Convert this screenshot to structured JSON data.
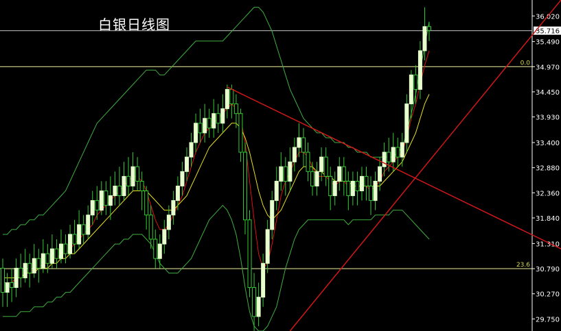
{
  "title": "白银日线图",
  "chart_data": {
    "type": "candlestick",
    "title": "白银日线图",
    "ylim": [
      29.5,
      36.35
    ],
    "y_ticks": [
      "36.020",
      "35.490",
      "34.970",
      "34.450",
      "33.930",
      "33.400",
      "32.880",
      "32.360",
      "31.840",
      "31.310",
      "30.790",
      "30.270",
      "29.750"
    ],
    "current_price": "35.716",
    "fib_levels": [
      {
        "label": "0.0",
        "value": 34.97
      },
      {
        "label": "23.6",
        "value": 30.79
      }
    ],
    "candles": [
      [
        30.8,
        30.3,
        31.0,
        30.0
      ],
      [
        30.3,
        30.5,
        30.7,
        30.0
      ],
      [
        30.5,
        30.4,
        30.8,
        30.1
      ],
      [
        30.4,
        30.8,
        31.0,
        30.2
      ],
      [
        30.8,
        30.6,
        31.1,
        30.4
      ],
      [
        30.6,
        30.9,
        31.2,
        30.5
      ],
      [
        30.9,
        30.7,
        31.1,
        30.4
      ],
      [
        30.7,
        31.0,
        31.3,
        30.6
      ],
      [
        31.0,
        30.8,
        31.2,
        30.5
      ],
      [
        30.8,
        31.1,
        31.4,
        30.7
      ],
      [
        31.1,
        30.9,
        31.3,
        30.7
      ],
      [
        30.9,
        31.2,
        31.5,
        30.8
      ],
      [
        31.2,
        31.0,
        31.4,
        30.8
      ],
      [
        31.0,
        31.3,
        31.6,
        30.9
      ],
      [
        31.3,
        31.1,
        31.5,
        30.9
      ],
      [
        31.1,
        31.5,
        31.7,
        31.0
      ],
      [
        31.5,
        31.3,
        31.8,
        31.1
      ],
      [
        31.3,
        31.7,
        32.0,
        31.2
      ],
      [
        31.7,
        31.5,
        31.9,
        31.3
      ],
      [
        31.5,
        31.9,
        32.1,
        31.4
      ],
      [
        31.9,
        32.2,
        32.4,
        31.7
      ],
      [
        32.2,
        32.0,
        32.5,
        31.8
      ],
      [
        32.0,
        32.4,
        32.6,
        31.9
      ],
      [
        32.4,
        32.1,
        32.6,
        31.9
      ],
      [
        32.1,
        32.3,
        32.7,
        31.8
      ],
      [
        32.3,
        32.5,
        32.8,
        32.1
      ],
      [
        32.5,
        32.3,
        32.9,
        32.1
      ],
      [
        32.3,
        32.7,
        33.0,
        32.2
      ],
      [
        32.7,
        32.5,
        33.1,
        32.3
      ],
      [
        32.5,
        32.9,
        33.2,
        32.4
      ],
      [
        32.9,
        32.6,
        33.1,
        32.4
      ],
      [
        32.6,
        32.4,
        32.8,
        32.0
      ],
      [
        32.4,
        31.9,
        32.5,
        31.6
      ],
      [
        31.9,
        31.4,
        32.1,
        31.2
      ],
      [
        31.4,
        31.0,
        31.6,
        30.8
      ],
      [
        31.0,
        31.3,
        31.5,
        30.8
      ],
      [
        31.3,
        31.6,
        31.8,
        31.1
      ],
      [
        31.6,
        31.9,
        32.1,
        31.4
      ],
      [
        31.9,
        32.2,
        32.4,
        31.7
      ],
      [
        32.2,
        32.5,
        32.7,
        32.0
      ],
      [
        32.5,
        32.8,
        33.0,
        32.3
      ],
      [
        32.8,
        33.1,
        33.3,
        32.6
      ],
      [
        33.1,
        33.4,
        33.6,
        32.9
      ],
      [
        33.4,
        33.8,
        34.0,
        33.2
      ],
      [
        33.8,
        33.6,
        34.1,
        33.4
      ],
      [
        33.6,
        33.9,
        34.2,
        33.4
      ],
      [
        33.9,
        33.7,
        34.1,
        33.5
      ],
      [
        33.7,
        34.0,
        34.3,
        33.5
      ],
      [
        34.0,
        33.8,
        34.2,
        33.6
      ],
      [
        33.8,
        34.1,
        34.4,
        33.6
      ],
      [
        34.1,
        34.5,
        34.6,
        33.9
      ],
      [
        34.5,
        34.2,
        34.6,
        33.9
      ],
      [
        34.2,
        34.0,
        34.4,
        33.7
      ],
      [
        34.0,
        33.2,
        34.1,
        33.0
      ],
      [
        33.2,
        31.8,
        33.4,
        31.5
      ],
      [
        31.8,
        30.4,
        32.0,
        30.2
      ],
      [
        30.4,
        29.8,
        30.7,
        29.5
      ],
      [
        29.8,
        30.2,
        30.5,
        29.6
      ],
      [
        30.2,
        30.9,
        31.1,
        30.0
      ],
      [
        30.9,
        31.6,
        31.8,
        30.7
      ],
      [
        31.6,
        32.2,
        32.4,
        31.4
      ],
      [
        32.2,
        32.6,
        32.9,
        32.0
      ],
      [
        32.6,
        32.9,
        33.2,
        32.4
      ],
      [
        32.9,
        32.6,
        33.1,
        32.3
      ],
      [
        32.6,
        33.0,
        33.3,
        32.4
      ],
      [
        33.0,
        33.3,
        33.5,
        32.8
      ],
      [
        33.3,
        33.5,
        33.8,
        33.1
      ],
      [
        33.5,
        33.2,
        33.7,
        32.9
      ],
      [
        33.2,
        32.8,
        33.4,
        32.6
      ],
      [
        32.8,
        32.5,
        33.0,
        32.3
      ],
      [
        32.5,
        32.8,
        33.0,
        32.3
      ],
      [
        32.8,
        33.1,
        33.3,
        32.6
      ],
      [
        33.1,
        32.7,
        33.3,
        32.5
      ],
      [
        32.7,
        32.3,
        32.9,
        32.0
      ],
      [
        32.3,
        32.6,
        32.8,
        32.1
      ],
      [
        32.6,
        32.9,
        33.1,
        32.4
      ],
      [
        32.9,
        32.6,
        33.1,
        32.3
      ],
      [
        32.6,
        32.3,
        32.8,
        32.0
      ],
      [
        32.3,
        32.6,
        32.8,
        32.1
      ],
      [
        32.6,
        32.4,
        32.8,
        32.1
      ],
      [
        32.4,
        32.7,
        32.9,
        32.2
      ],
      [
        32.7,
        32.5,
        32.9,
        32.2
      ],
      [
        32.5,
        32.2,
        32.7,
        31.9
      ],
      [
        32.2,
        32.6,
        32.8,
        32.0
      ],
      [
        32.6,
        32.9,
        33.1,
        32.4
      ],
      [
        32.9,
        33.2,
        33.4,
        32.7
      ],
      [
        33.2,
        33.0,
        33.5,
        32.8
      ],
      [
        33.0,
        33.3,
        33.6,
        32.8
      ],
      [
        33.3,
        33.1,
        33.5,
        32.9
      ],
      [
        33.1,
        33.4,
        33.6,
        32.9
      ],
      [
        33.4,
        34.2,
        34.4,
        33.2
      ],
      [
        34.2,
        34.8,
        34.9,
        33.9
      ],
      [
        34.8,
        34.5,
        35.0,
        34.2
      ],
      [
        34.5,
        35.3,
        35.5,
        34.3
      ],
      [
        35.3,
        35.8,
        36.2,
        35.1
      ],
      [
        35.8,
        35.72,
        35.9,
        35.5
      ]
    ],
    "series": [
      {
        "values": [
          30.5,
          30.5,
          30.5,
          30.6,
          30.6,
          30.7,
          30.7,
          30.8,
          30.8,
          30.9,
          30.9,
          31.0,
          31.0,
          31.1,
          31.1,
          31.2,
          31.3,
          31.4,
          31.5,
          31.6,
          31.7,
          31.9,
          32.0,
          32.1,
          32.2,
          32.3,
          32.4,
          32.5,
          32.6,
          32.7,
          32.7,
          32.6,
          32.4,
          32.1,
          31.8,
          31.6,
          31.6,
          31.7,
          31.9,
          32.1,
          32.3,
          32.6,
          32.9,
          33.2,
          33.4,
          33.6,
          33.7,
          33.8,
          33.9,
          34.0,
          34.1,
          34.2,
          34.1,
          33.9,
          33.4,
          32.6,
          31.8,
          31.1,
          30.8,
          30.9,
          31.3,
          31.8,
          32.3,
          32.6,
          32.8,
          33.0,
          33.2,
          33.2,
          33.1,
          32.9,
          32.7,
          32.7,
          32.7,
          32.6,
          32.5,
          32.6,
          32.6,
          32.5,
          32.5,
          32.5,
          32.5,
          32.5,
          32.4,
          32.5,
          32.6,
          32.8,
          32.9,
          33.0,
          33.1,
          33.2,
          33.5,
          33.9,
          34.2,
          34.6,
          35.0,
          35.3
        ]
      },
      {
        "values": [
          30.6,
          30.6,
          30.6,
          30.6,
          30.6,
          30.7,
          30.7,
          30.7,
          30.8,
          30.8,
          30.8,
          30.9,
          30.9,
          31.0,
          31.0,
          31.1,
          31.1,
          31.2,
          31.3,
          31.4,
          31.5,
          31.6,
          31.7,
          31.8,
          31.9,
          32.0,
          32.1,
          32.2,
          32.3,
          32.4,
          32.4,
          32.4,
          32.4,
          32.3,
          32.2,
          32.1,
          32.0,
          32.0,
          32.0,
          32.1,
          32.2,
          32.3,
          32.5,
          32.7,
          32.9,
          33.1,
          33.3,
          33.4,
          33.5,
          33.6,
          33.7,
          33.8,
          33.8,
          33.7,
          33.5,
          33.2,
          32.8,
          32.4,
          32.1,
          31.9,
          31.8,
          31.9,
          32.0,
          32.2,
          32.4,
          32.6,
          32.8,
          32.9,
          32.9,
          32.9,
          32.8,
          32.8,
          32.7,
          32.7,
          32.6,
          32.6,
          32.6,
          32.6,
          32.5,
          32.5,
          32.5,
          32.5,
          32.5,
          32.5,
          32.5,
          32.6,
          32.7,
          32.8,
          32.9,
          33.0,
          33.2,
          33.4,
          33.6,
          33.9,
          34.2,
          34.4
        ]
      },
      {
        "values": [
          31.5,
          31.5,
          31.6,
          31.6,
          31.7,
          31.7,
          31.8,
          31.8,
          31.9,
          31.9,
          32.0,
          32.1,
          32.2,
          32.3,
          32.4,
          32.6,
          32.8,
          33.0,
          33.2,
          33.4,
          33.6,
          33.8,
          33.9,
          34.0,
          34.1,
          34.2,
          34.3,
          34.4,
          34.5,
          34.6,
          34.7,
          34.8,
          34.9,
          34.9,
          34.9,
          34.8,
          34.8,
          34.9,
          35.0,
          35.1,
          35.2,
          35.3,
          35.4,
          35.5,
          35.5,
          35.5,
          35.5,
          35.5,
          35.5,
          35.5,
          35.6,
          35.7,
          35.8,
          35.9,
          36.0,
          36.1,
          36.2,
          36.2,
          36.1,
          35.9,
          35.7,
          35.4,
          35.1,
          34.8,
          34.5,
          34.3,
          34.1,
          33.9,
          33.8,
          33.7,
          33.6,
          33.6,
          33.5,
          33.5,
          33.4,
          33.4,
          33.4,
          33.3,
          33.3,
          33.2,
          33.2,
          33.2,
          33.1,
          33.1,
          33.1,
          33.1,
          33.1,
          33.1,
          33.2,
          33.3,
          33.6,
          34.0,
          34.4,
          34.9,
          35.4,
          35.9
        ]
      },
      {
        "values": [
          29.8,
          29.8,
          29.8,
          29.8,
          29.9,
          29.9,
          29.9,
          30.0,
          30.0,
          30.0,
          30.1,
          30.1,
          30.2,
          30.2,
          30.3,
          30.3,
          30.4,
          30.5,
          30.6,
          30.7,
          30.8,
          30.9,
          31.0,
          31.1,
          31.2,
          31.3,
          31.3,
          31.4,
          31.4,
          31.5,
          31.5,
          31.5,
          31.4,
          31.3,
          31.1,
          30.9,
          30.8,
          30.7,
          30.7,
          30.7,
          30.8,
          30.9,
          31.0,
          31.2,
          31.4,
          31.6,
          31.8,
          31.9,
          32.0,
          32.1,
          32.0,
          31.8,
          31.5,
          31.0,
          30.4,
          29.9,
          29.6,
          29.5,
          29.5,
          29.6,
          29.8,
          30.0,
          30.4,
          30.8,
          31.1,
          31.4,
          31.6,
          31.7,
          31.8,
          31.8,
          31.8,
          31.8,
          31.8,
          31.8,
          31.8,
          31.8,
          31.8,
          31.7,
          31.8,
          31.8,
          31.8,
          31.8,
          31.8,
          31.9,
          31.9,
          31.9,
          31.9,
          32.0,
          32.0,
          32.0,
          31.9,
          31.8,
          31.7,
          31.6,
          31.5,
          31.4
        ]
      }
    ],
    "trend_lines": [
      {
        "from": [
          50,
          34.55
        ],
        "to": [
          97,
          31.2
        ]
      },
      {
        "from": [
          64,
          29.5
        ],
        "to": [
          97,
          36.35
        ]
      }
    ]
  }
}
